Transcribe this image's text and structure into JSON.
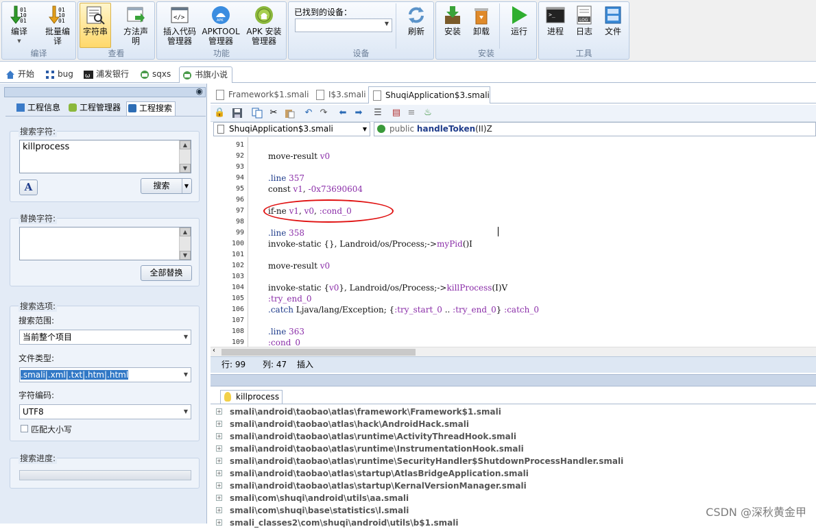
{
  "ribbon": {
    "compile_group": {
      "caption": "编译",
      "compile": "编译",
      "batch_compile": "批量编译"
    },
    "view_group": {
      "caption": "查看",
      "strings": "字符串",
      "method_decl": "方法声明"
    },
    "function_group": {
      "caption": "功能",
      "insert_code": "插入代码管理器",
      "apktool": "APKTOOL管理器",
      "apk_install": "APK 安装管理器"
    },
    "device_group": {
      "caption": "设备",
      "found_devices_label": "已找到的设备：",
      "device_value": "",
      "refresh": "刷新"
    },
    "install_group": {
      "caption": "安装",
      "install": "安装",
      "uninstall": "卸载",
      "run": "运行"
    },
    "tools_group": {
      "caption": "工具",
      "process": "进程",
      "log": "日志",
      "file": "文件",
      "log_badge": "LOG"
    }
  },
  "doc_tabs": [
    {
      "label": "开始"
    },
    {
      "label": "bug"
    },
    {
      "label": "浦发银行"
    },
    {
      "label": "sqxs"
    },
    {
      "label": "书旗小说"
    }
  ],
  "left_panel": {
    "tabs": [
      "工程信息",
      "工程管理器",
      "工程搜索"
    ],
    "search": {
      "title": "搜索字符:",
      "value": "killprocess",
      "button": "搜索"
    },
    "replace": {
      "title": "替换字符:",
      "value": "",
      "button": "全部替换"
    },
    "options": {
      "title": "搜索选项:",
      "scope_label": "搜索范围:",
      "scope_value": "当前整个项目",
      "filetype_label": "文件类型:",
      "filetype_value": ".smali|.xml|.txt|.htm|.html",
      "encoding_label": "字符编码:",
      "encoding_value": "UTF8",
      "match_case": "匹配大小写"
    },
    "progress": {
      "title": "搜索进度:"
    }
  },
  "editor": {
    "tabs": [
      "Framework$1.smali",
      "I$3.smali",
      "ShuqiApplication$3.smali"
    ],
    "file_combo": "ShuqiApplication$3.smali",
    "method_combo": {
      "prefix": "public ",
      "name": "handleToken",
      "suffix": "(II)Z"
    },
    "line_numbers": [
      "91",
      "92",
      "93",
      "94",
      "95",
      "96",
      "97",
      "98",
      "99",
      "100",
      "101",
      "102",
      "103",
      "104",
      "105",
      "106",
      "107",
      "108",
      "109"
    ],
    "lines": [
      "",
      "move-result v0",
      "",
      ".line 357",
      "const v1, -0x73690604",
      "",
      "if-ne v1, v0, :cond_0",
      "",
      ".line 358",
      "invoke-static {}, Landroid/os/Process;->myPid()I",
      "",
      "move-result v0",
      "",
      "invoke-static {v0}, Landroid/os/Process;->killProcess(I)V",
      ":try_end_0",
      ".catch Ljava/lang/Exception; {:try_start_0 .. :try_end_0} :catch_0",
      "",
      ".line 363",
      ":cond_0"
    ],
    "status": {
      "row": "行: 99",
      "col": "列: 47",
      "mode": "插入"
    }
  },
  "results": {
    "tab": "killprocess",
    "items": [
      "smali\\android\\taobao\\atlas\\framework\\Framework$1.smali",
      "smali\\android\\taobao\\atlas\\hack\\AndroidHack.smali",
      "smali\\android\\taobao\\atlas\\runtime\\ActivityThreadHook.smali",
      "smali\\android\\taobao\\atlas\\runtime\\InstrumentationHook.smali",
      "smali\\android\\taobao\\atlas\\runtime\\SecurityHandler$ShutdownProcessHandler.smali",
      "smali\\android\\taobao\\atlas\\startup\\AtlasBridgeApplication.smali",
      "smali\\android\\taobao\\atlas\\startup\\KernalVersionManager.smali",
      "smali\\com\\shuqi\\android\\utils\\aa.smali",
      "smali\\com\\shuqi\\base\\statistics\\l.smali",
      "smali_classes2\\com\\shuqi\\android\\utils\\b$1.smali"
    ]
  },
  "watermark": "CSDN @深秋黄金甲",
  "colors": {
    "accent": "#1f5fb4",
    "annotation": "#e01010",
    "ribbon_bg": "#dce7f5"
  }
}
